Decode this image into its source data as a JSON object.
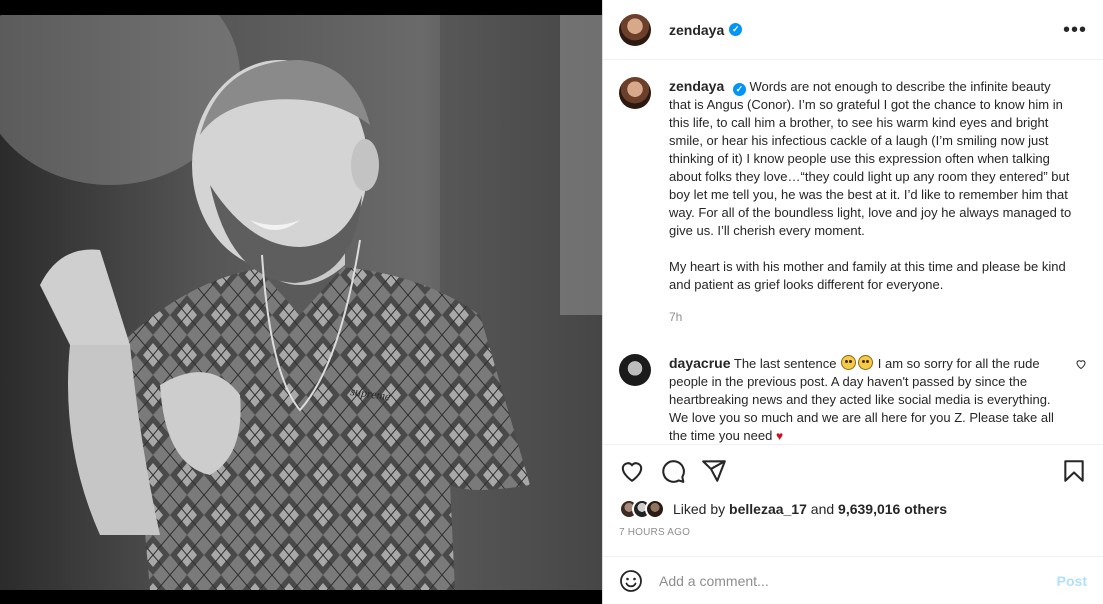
{
  "post": {
    "username": "zendaya",
    "verified": true,
    "photo_alt": "Black and white photo of a smiling man with a beard wearing an argyle knit polo shirt",
    "caption_paragraphs": [
      "Words are not enough to describe the infinite beauty that is Angus (Conor). I’m so grateful I got the chance to know him in this life, to call him a brother, to see his warm kind eyes and bright smile, or hear his infectious cackle of a laugh (I’m smiling now just thinking of it) I know people use this expression often when talking about folks they love…“they could light up any room they entered” but boy let me tell you, he was the best at it. I’d like to remember him that way. For all of the boundless light, love and joy he always managed to give us. I’ll cherish every moment.",
      "My heart is with his mother and family at this time and please be kind and patient as grief looks different for everyone."
    ],
    "caption_time": "7h"
  },
  "comments": [
    {
      "username": "dayacrue",
      "text_before_emoji": "The last sentence",
      "text_after_emoji": "I am so sorry for all the rude people in the previous post. A day haven't passed by since the heartbreaking news and they acted like social media is everything. We love you so much and we are all here for you Z. Please take all the time you need"
    }
  ],
  "likes": {
    "prefix": "Liked by",
    "first_user": "bellezaa_17",
    "middle": "and",
    "count_text": "9,639,016 others"
  },
  "time_ago": "7 HOURS AGO",
  "comment_box": {
    "placeholder": "Add a comment...",
    "post_label": "Post"
  },
  "icons": {
    "more": "more-options-icon",
    "like": "heart-outline-icon",
    "comment": "comment-bubble-icon",
    "share": "paper-plane-icon",
    "save": "bookmark-icon",
    "emoji": "smiley-icon"
  },
  "colors": {
    "verified_blue": "#0095f6",
    "post_button_disabled": "#b2dffc",
    "secondary_text": "#8e8e8e"
  }
}
